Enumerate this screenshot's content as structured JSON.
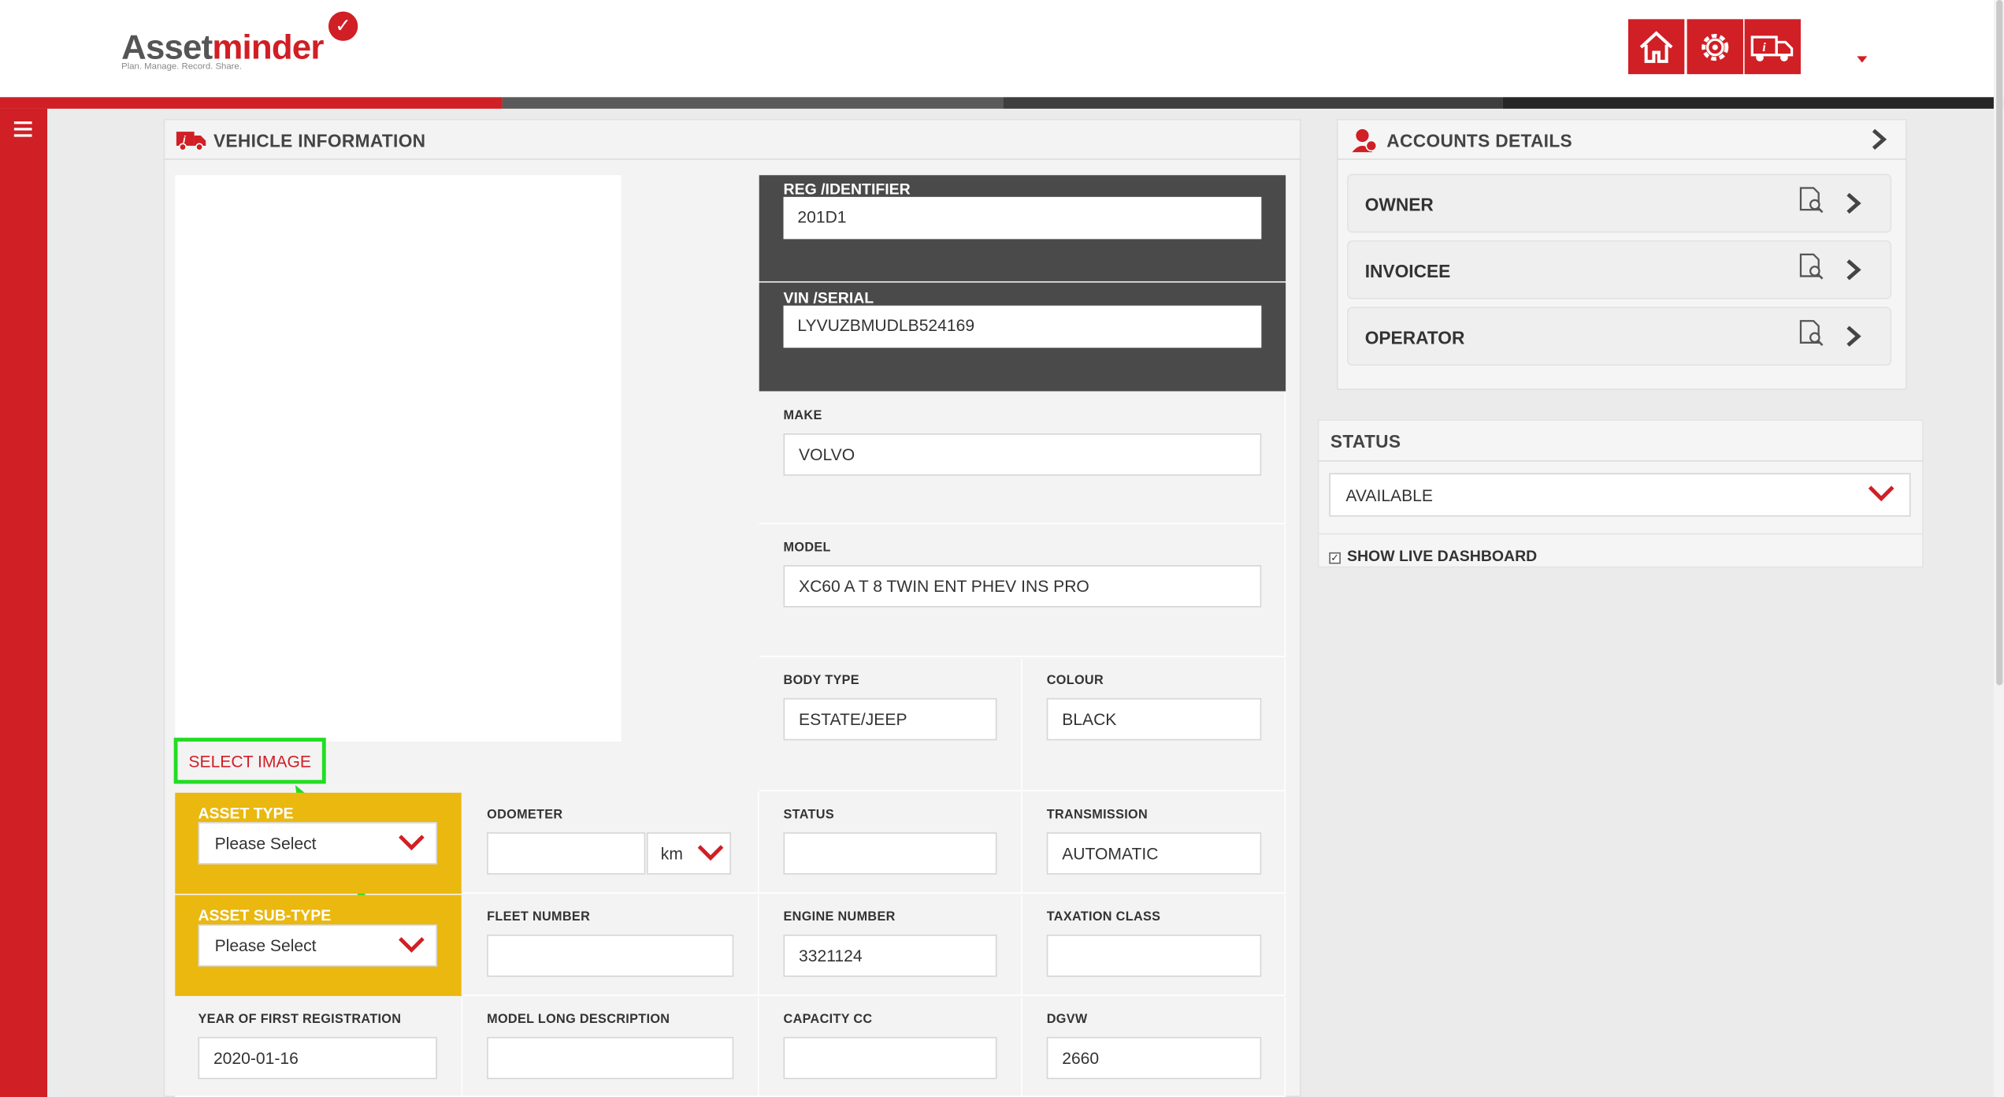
{
  "header": {
    "logo_part1": "Asset",
    "logo_part2": "minder",
    "tagline": "Plan. Manage. Record. Share."
  },
  "vehicle": {
    "title": "VEHICLE INFORMATION",
    "select_image": "SELECT IMAGE",
    "reg_label": "REG /IDENTIFIER",
    "reg_value": "201D1",
    "vin_label": "VIN /SERIAL",
    "vin_value": "LYVUZBMUDLB524169",
    "make_label": "MAKE",
    "make_value": "VOLVO",
    "model_label": "MODEL",
    "model_value": "XC60 A T 8 TWIN ENT PHEV INS PRO",
    "body_label": "BODY TYPE",
    "body_value": "ESTATE/JEEP",
    "colour_label": "COLOUR",
    "colour_value": "BLACK",
    "asset_type_label": "ASSET TYPE",
    "asset_type_value": "Please Select",
    "odometer_label": "ODOMETER",
    "odometer_value": "",
    "odometer_unit": "km",
    "status_label": "STATUS",
    "status_value": "",
    "transmission_label": "TRANSMISSION",
    "transmission_value": "AUTOMATIC",
    "asset_subtype_label": "ASSET SUB-TYPE",
    "asset_subtype_value": "Please Select",
    "fleet_label": "FLEET NUMBER",
    "fleet_value": "",
    "engine_label": "ENGINE NUMBER",
    "engine_value": "3321124",
    "tax_label": "TAXATION CLASS",
    "tax_value": "",
    "year_label": "YEAR OF FIRST REGISTRATION",
    "year_value": "2020-01-16",
    "model_long_label": "MODEL LONG DESCRIPTION",
    "model_long_value": "",
    "capacity_label": "CAPACITY CC",
    "capacity_value": "",
    "dgvw_label": "DGVW",
    "dgvw_value": "2660"
  },
  "accounts": {
    "title": "ACCOUNTS DETAILS",
    "rows": [
      "OWNER",
      "INVOICEE",
      "OPERATOR"
    ]
  },
  "status_panel": {
    "title": "STATUS",
    "value": "AVAILABLE",
    "checkbox_label": "SHOW LIVE DASHBOARD",
    "checkbox_checked": true
  },
  "colors": {
    "brand_red": "#d01f25",
    "dark_grey": "#4a4a4a",
    "yellow": "#eab80f",
    "highlight_green": "#22dd22"
  }
}
